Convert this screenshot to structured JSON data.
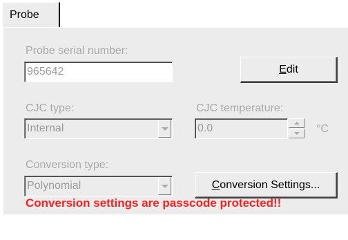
{
  "tabs": [
    {
      "label": "Probe"
    }
  ],
  "probe_serial": {
    "label": "Probe serial number:",
    "value": "965642"
  },
  "edit_button": {
    "label_underlined": "E",
    "label_rest": "dit"
  },
  "cjc_type": {
    "label": "CJC type:",
    "value": "Internal"
  },
  "cjc_temperature": {
    "label": "CJC temperature:",
    "value": "0.0",
    "unit": "°C"
  },
  "conversion_type": {
    "label": "Conversion type:",
    "value": "Polynomial"
  },
  "conversion_settings_button": {
    "label_underlined": "C",
    "label_rest": "onversion Settings..."
  },
  "warning": {
    "text": "Conversion settings are passcode protected!!",
    "color": "#ff1f1f"
  },
  "colors": {
    "panel": "#ececec",
    "disabled_text": "#a9a9a9"
  }
}
